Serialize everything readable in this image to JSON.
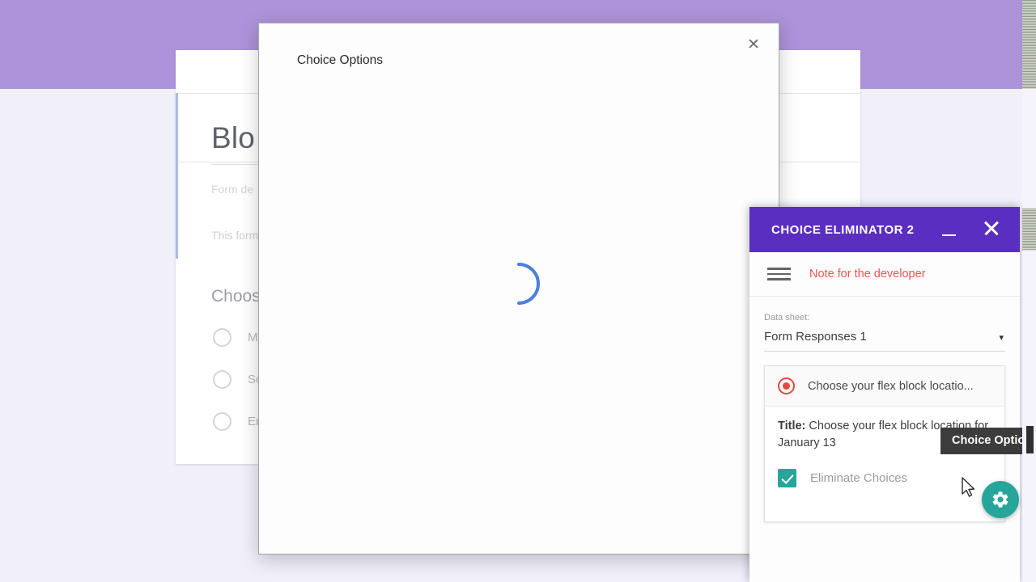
{
  "form": {
    "title": "Blo",
    "description_placeholder": "Form de",
    "sub_description": "This form",
    "question": "Choos",
    "options": [
      {
        "label": "Ma"
      },
      {
        "label": "Sci"
      },
      {
        "label": "Eng"
      }
    ]
  },
  "modal": {
    "title": "Choice Options",
    "close_icon": "close-icon",
    "state": "loading",
    "spinner_color": "#4a7fdb"
  },
  "panel": {
    "header": {
      "title": "CHOICE ELIMINATOR 2",
      "background": "#5b2ec2",
      "minimize_icon": "minimize-icon",
      "close_icon": "close-icon"
    },
    "toolbar": {
      "menu_icon": "hamburger-menu-icon",
      "note_label": "Note for the developer",
      "note_color": "#ef5350"
    },
    "data_sheet": {
      "label": "Data sheet:",
      "value": "Form Responses 1",
      "caret": "▾"
    },
    "question_card": {
      "type_icon": "radio-button-icon",
      "type_icon_color": "#e8483b",
      "header_label": "Choose your flex block locatio...",
      "title_prefix": "Title:",
      "title_value": "Choose your flex block location for January 13",
      "eliminate_label": "Eliminate Choices",
      "eliminate_checked": true,
      "eliminate_color": "#26a69a",
      "fab_icon": "gear-icon",
      "fab_color": "#26a69a"
    }
  },
  "tooltip": {
    "text": "Choice Options",
    "background": "#3c3c3c"
  },
  "theme": {
    "forms_band": "#ad93d9",
    "page_background": "#f1effa",
    "panel_purple": "#5b2ec2"
  }
}
